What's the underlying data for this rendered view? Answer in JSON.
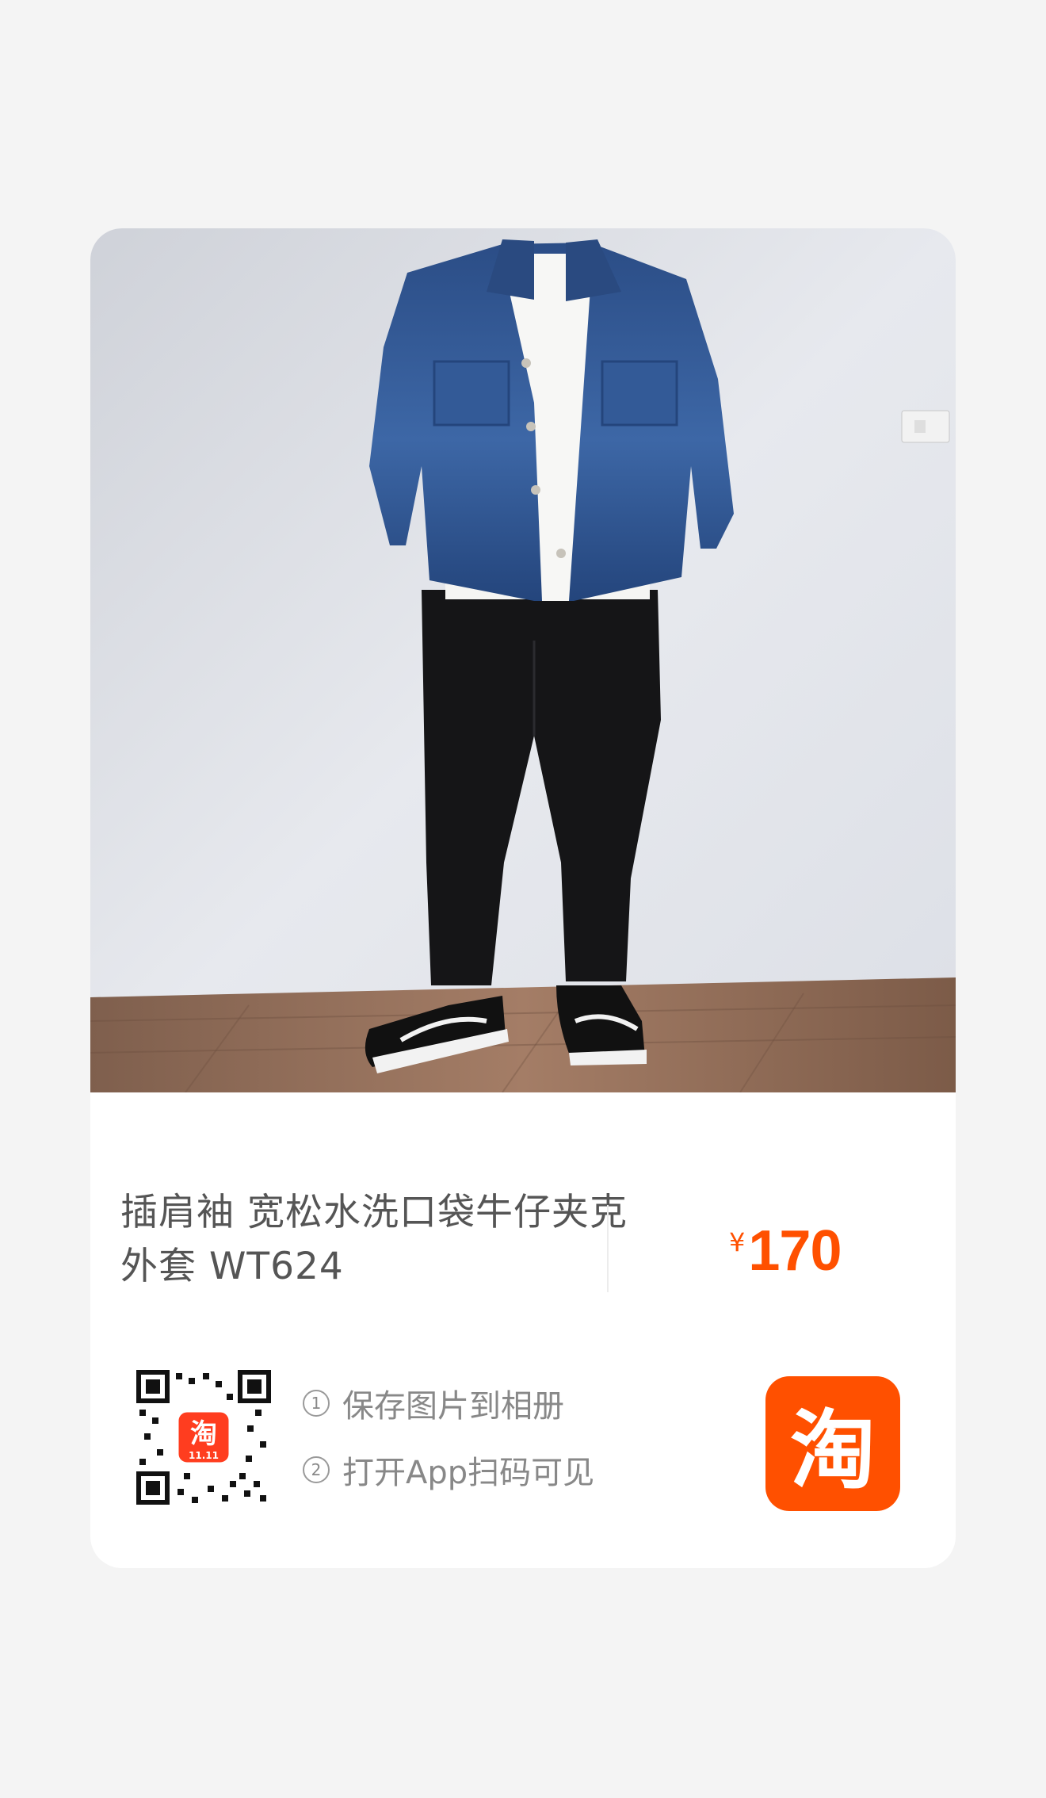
{
  "product": {
    "title": "插肩袖 宽松水洗口袋牛仔夹克外套 WT624",
    "currency": "¥",
    "price": "170"
  },
  "share": {
    "steps": [
      {
        "num": "1",
        "text": "保存图片到相册"
      },
      {
        "num": "2",
        "text": "打开App扫码可见"
      }
    ],
    "qr_badge_char": "淘",
    "qr_badge_sub": "11.11",
    "app_logo_char": "淘"
  },
  "colors": {
    "brand_orange": "#ff5000",
    "page_bg": "#f4f4f4",
    "card_bg": "#ffffff"
  },
  "icons": [
    "qr-code-icon",
    "taobao-app-icon"
  ]
}
